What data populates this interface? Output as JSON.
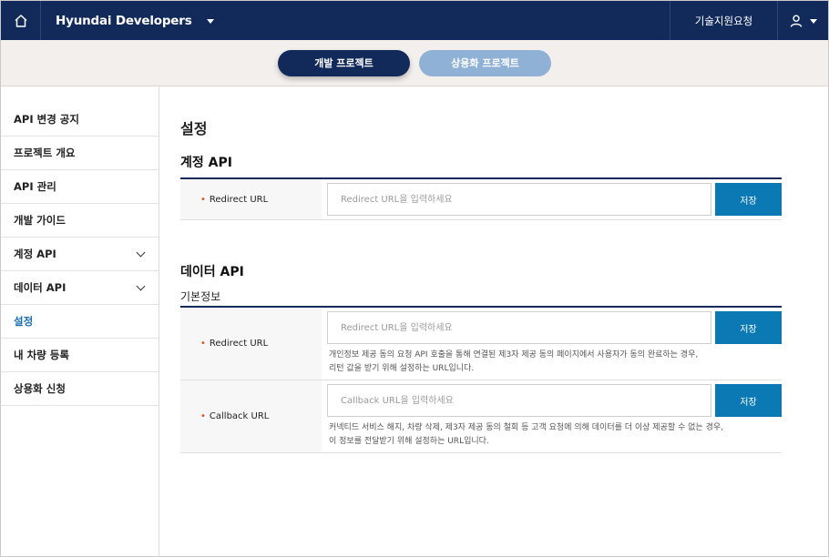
{
  "topbar": {
    "brand": "Hyundai Developers",
    "support_label": "기술지원요청"
  },
  "projects": {
    "tabs": [
      {
        "label": "개발 프로젝트",
        "active": true
      },
      {
        "label": "상용화 프로젝트",
        "active": false
      }
    ]
  },
  "sidebar": {
    "items": [
      {
        "label": "API 변경 공지"
      },
      {
        "label": "프로젝트 개요"
      },
      {
        "label": "API 관리"
      },
      {
        "label": "개발 가이드"
      },
      {
        "label": "계정 API",
        "expandable": true
      },
      {
        "label": "데이터 API",
        "expandable": true
      },
      {
        "label": "설정",
        "active": true
      },
      {
        "label": "내 차량 등록"
      },
      {
        "label": "상용화 신청"
      }
    ]
  },
  "main": {
    "page_title": "설정",
    "account_api": {
      "title": "계정 API",
      "redirect": {
        "label": "Redirect URL",
        "placeholder": "Redirect URL을 입력하세요",
        "save_label": "저장"
      }
    },
    "data_api": {
      "title": "데이터 API",
      "subtitle": "기본정보",
      "redirect": {
        "label": "Redirect URL",
        "placeholder": "Redirect URL을 입력하세요",
        "save_label": "저장",
        "help_line1": "개인정보 제공 동의 요청 API 호출을 통해 연결된 제3자 제공 동의 페이지에서 사용자가 동의 완료하는 경우,",
        "help_line2": "리턴 값을 받기 위해 설정하는 URL입니다."
      },
      "callback": {
        "label": "Callback URL",
        "placeholder": "Callback URL을 입력하세요",
        "save_label": "저장",
        "help_line1": "커넥티드 서비스 해지, 차량 삭제, 제3자 제공 동의 철회 등 고객 요청에 의해 데이터를 더 이상 제공할 수 없는 경우,",
        "help_line2": "이 정보를 전달받기 위해 설정하는 URL입니다."
      }
    }
  },
  "colors": {
    "navy": "#122a5a",
    "accent_blue": "#0b79b3",
    "inactive_pill": "#8fb1d6",
    "required_dot": "#e04b2a"
  },
  "icons": [
    "home-icon",
    "chevron-down-icon",
    "user-icon"
  ]
}
